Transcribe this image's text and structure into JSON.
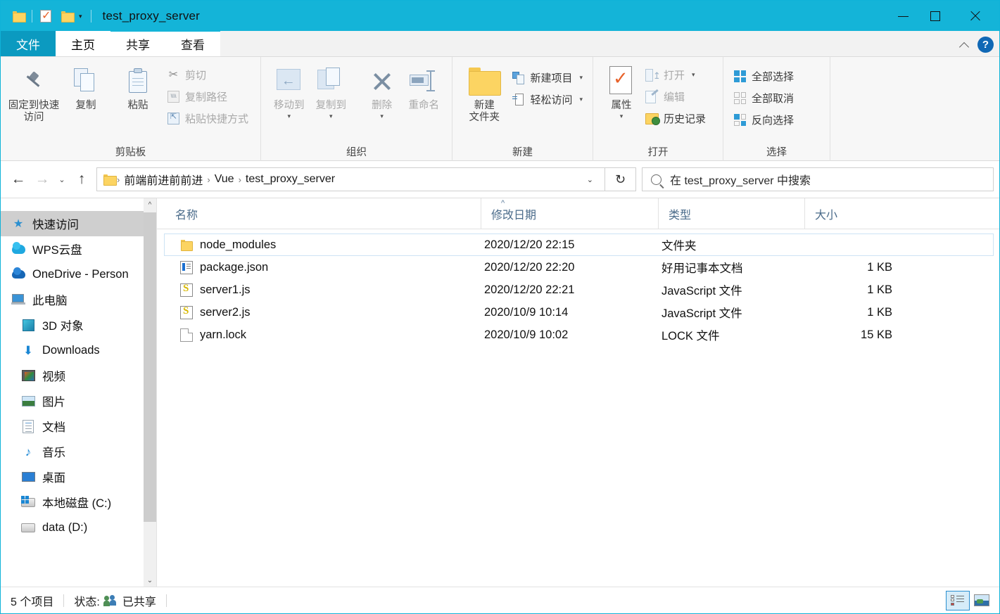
{
  "titlebar": {
    "title": "test_proxy_server",
    "quick_access": [
      {
        "name": "explorer-icon",
        "label": ""
      },
      {
        "name": "properties-check-icon",
        "label": ""
      },
      {
        "name": "new-folder-icon",
        "label": ""
      }
    ],
    "customize_caret": "▾",
    "minimize": "—",
    "maximize": "□",
    "close": "✕"
  },
  "tabs": [
    {
      "label": "文件",
      "state": "file"
    },
    {
      "label": "主页",
      "state": "active"
    },
    {
      "label": "共享",
      "state": "normal"
    },
    {
      "label": "查看",
      "state": "normal"
    }
  ],
  "tab_right": {
    "collapse": "^",
    "help": "?"
  },
  "ribbon": {
    "groups": [
      {
        "label": "剪贴板",
        "big": [
          {
            "label": "固定到快速访问",
            "icon": "pin-icon"
          },
          {
            "label": "复制",
            "icon": "copy-icon"
          },
          {
            "label": "粘贴",
            "icon": "paste-icon"
          }
        ],
        "small": [
          {
            "label": "剪切",
            "icon": "scissors-icon"
          },
          {
            "label": "复制路径",
            "icon": "copy-path-icon"
          },
          {
            "label": "粘贴快捷方式",
            "icon": "paste-shortcut-icon"
          }
        ]
      },
      {
        "label": "组织",
        "big": [
          {
            "label": "移动到",
            "icon": "move-to-icon",
            "caret": "▾"
          },
          {
            "label": "复制到",
            "icon": "copy-to-icon",
            "caret": "▾"
          },
          {
            "label": "删除",
            "icon": "delete-icon",
            "caret": "▾"
          },
          {
            "label": "重命名",
            "icon": "rename-icon"
          }
        ]
      },
      {
        "label": "新建",
        "big": [
          {
            "label": "新建\n文件夹",
            "line1": "新建",
            "line2": "文件夹",
            "icon": "new-folder-icon"
          }
        ],
        "small": [
          {
            "label": "新建项目",
            "icon": "new-item-icon",
            "caret": "▾"
          },
          {
            "label": "轻松访问",
            "icon": "easy-access-icon",
            "caret": "▾"
          }
        ]
      },
      {
        "label": "打开",
        "big": [
          {
            "label": "属性",
            "icon": "properties-icon",
            "caret": "▾"
          }
        ],
        "small": [
          {
            "label": "打开",
            "icon": "open-icon",
            "caret": "▾"
          },
          {
            "label": "编辑",
            "icon": "edit-icon"
          },
          {
            "label": "历史记录",
            "icon": "history-icon"
          }
        ]
      },
      {
        "label": "选择",
        "small": [
          {
            "label": "全部选择",
            "icon": "select-all-icon"
          },
          {
            "label": "全部取消",
            "icon": "select-none-icon"
          },
          {
            "label": "反向选择",
            "icon": "invert-selection-icon"
          }
        ]
      }
    ]
  },
  "addressbar": {
    "back": "←",
    "forward": "→",
    "history_caret": "⌄",
    "up": "↑",
    "breadcrumbs": [
      "前端前进前前进",
      "Vue",
      "test_proxy_server"
    ],
    "separator": "›",
    "dropdown_caret": "⌄",
    "refresh": "↻",
    "search_placeholder": "在 test_proxy_server 中搜索"
  },
  "navpane": {
    "items": [
      {
        "label": "快速访问",
        "icon": "star-pin-icon",
        "indent": 0,
        "selected": true
      },
      {
        "label": "WPS云盘",
        "icon": "wps-cloud-icon",
        "indent": 0,
        "selected": false
      },
      {
        "label": "OneDrive - Person",
        "icon": "onedrive-cloud-icon",
        "indent": 0,
        "selected": false
      },
      {
        "label": "此电脑",
        "icon": "this-pc-icon",
        "indent": 0,
        "selected": false
      },
      {
        "label": "3D 对象",
        "icon": "3d-objects-icon",
        "indent": 1,
        "selected": false
      },
      {
        "label": "Downloads",
        "icon": "downloads-icon",
        "indent": 1,
        "selected": false
      },
      {
        "label": "视频",
        "icon": "videos-icon",
        "indent": 1,
        "selected": false
      },
      {
        "label": "图片",
        "icon": "pictures-icon",
        "indent": 1,
        "selected": false
      },
      {
        "label": "文档",
        "icon": "documents-icon",
        "indent": 1,
        "selected": false
      },
      {
        "label": "音乐",
        "icon": "music-icon",
        "indent": 1,
        "selected": false
      },
      {
        "label": "桌面",
        "icon": "desktop-icon",
        "indent": 1,
        "selected": false
      },
      {
        "label": "本地磁盘 (C:)",
        "icon": "local-disk-icon",
        "indent": 1,
        "selected": false
      },
      {
        "label": "data (D:)",
        "icon": "drive-icon",
        "indent": 1,
        "selected": false
      }
    ],
    "scroll_up": "^",
    "scroll_down": "⌄"
  },
  "filelist": {
    "sort_indicator": "^",
    "columns": [
      {
        "key": "name",
        "label": "名称"
      },
      {
        "key": "date",
        "label": "修改日期"
      },
      {
        "key": "type",
        "label": "类型"
      },
      {
        "key": "size",
        "label": "大小"
      }
    ],
    "rows": [
      {
        "name": "node_modules",
        "date": "2020/12/20 22:15",
        "type": "文件夹",
        "size": "",
        "icon": "folder-icon",
        "focused": true
      },
      {
        "name": "package.json",
        "date": "2020/12/20 22:20",
        "type": "好用记事本文档",
        "size": "1 KB",
        "icon": "notepad-doc-icon",
        "focused": false
      },
      {
        "name": "server1.js",
        "date": "2020/12/20 22:21",
        "type": "JavaScript 文件",
        "size": "1 KB",
        "icon": "javascript-file-icon",
        "focused": false
      },
      {
        "name": "server2.js",
        "date": "2020/10/9 10:14",
        "type": "JavaScript 文件",
        "size": "1 KB",
        "icon": "javascript-file-icon",
        "focused": false
      },
      {
        "name": "yarn.lock",
        "date": "2020/10/9 10:02",
        "type": "LOCK 文件",
        "size": "15 KB",
        "icon": "generic-file-icon",
        "focused": false
      }
    ]
  },
  "statusbar": {
    "item_count": "5 个项目",
    "status_label": "状态:",
    "shared_label": "已共享",
    "view_details": "details-view",
    "view_large_icons": "large-icons-view"
  },
  "colors": {
    "titlebar": "#14b4d8",
    "file_tab": "#0b9ac0",
    "accent": "#2a8fd0",
    "header_text": "#4a6b8a"
  }
}
